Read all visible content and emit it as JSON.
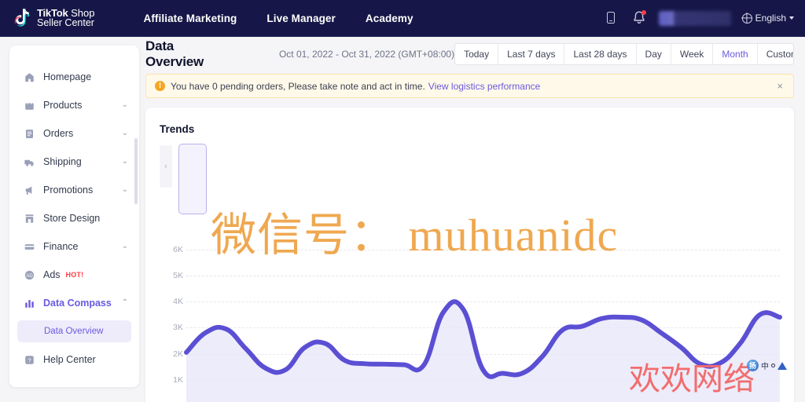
{
  "topnav": {
    "brand": {
      "line1_bold": "TikTok",
      "line1_rest": " Shop",
      "line2": "Seller Center"
    },
    "links": [
      {
        "label": "Affiliate Marketing"
      },
      {
        "label": "Live Manager"
      },
      {
        "label": "Academy"
      }
    ],
    "language": {
      "label": "English"
    },
    "icons": {
      "phone": "mobile-phone-icon",
      "bell": "notification-bell-icon",
      "globe": "globe-icon"
    }
  },
  "sidebar": {
    "items": [
      {
        "label": "Homepage",
        "icon": "home-icon",
        "caret": false,
        "active": false
      },
      {
        "label": "Products",
        "icon": "bag-icon",
        "caret": true,
        "active": false
      },
      {
        "label": "Orders",
        "icon": "document-icon",
        "caret": true,
        "active": false
      },
      {
        "label": "Shipping",
        "icon": "truck-icon",
        "caret": true,
        "active": false
      },
      {
        "label": "Promotions",
        "icon": "megaphone-icon",
        "caret": true,
        "active": false
      },
      {
        "label": "Store Design",
        "icon": "storefront-icon",
        "caret": false,
        "active": false
      },
      {
        "label": "Finance",
        "icon": "card-icon",
        "caret": true,
        "active": false
      },
      {
        "label": "Ads",
        "icon": "ads-icon",
        "caret": false,
        "active": false,
        "badge": "HOT!"
      },
      {
        "label": "Data Compass",
        "icon": "bar-chart-icon",
        "caret": true,
        "active": true
      },
      {
        "label": "Help Center",
        "icon": "help-icon",
        "caret": false,
        "active": false
      }
    ],
    "submenu": {
      "label": "Data Overview"
    },
    "caret_down": "⌄",
    "caret_up": "⌃"
  },
  "header": {
    "title": "Data Overview",
    "date_range": "Oct 01, 2022 - Oct 31, 2022 (GMT+08:00)",
    "ranges": [
      {
        "label": "Today",
        "selected": false
      },
      {
        "label": "Last 7 days",
        "selected": false
      },
      {
        "label": "Last 28 days",
        "selected": false
      },
      {
        "label": "Day",
        "selected": false
      },
      {
        "label": "Week",
        "selected": false
      },
      {
        "label": "Month",
        "selected": true
      },
      {
        "label": "Custom",
        "selected": false
      }
    ]
  },
  "alert": {
    "icon_glyph": "!",
    "text": "You have 0 pending orders, Please take note and act in time.",
    "link": "View logistics performance",
    "close_glyph": "×"
  },
  "trends_card": {
    "title": "Trends",
    "carousel_prev_glyph": "‹"
  },
  "chart_data": {
    "type": "area",
    "title": "Trends",
    "xlabel": "",
    "ylabel": "",
    "ylim": [
      0,
      6500
    ],
    "yticks": [
      6000,
      5000,
      4000,
      3000,
      2000,
      1000
    ],
    "ytick_labels": [
      "6K",
      "5K",
      "4K",
      "3K",
      "2K",
      "1K"
    ],
    "grid": true,
    "legend_position": "none",
    "line_color": "#5b4fd4",
    "fill_color": "#e7e5f8",
    "series": [
      {
        "name": "Trend",
        "x": [
          0,
          1,
          2,
          3,
          4,
          5,
          6,
          7,
          8,
          9,
          10,
          11,
          12,
          13,
          14,
          15,
          16,
          17,
          18,
          19,
          20,
          21,
          22,
          23,
          24,
          25,
          26,
          27,
          28,
          29,
          30
        ],
        "values": [
          2050,
          2820,
          2950,
          2200,
          1450,
          1380,
          2250,
          2400,
          1750,
          1620,
          1600,
          1580,
          1560,
          3600,
          3700,
          1380,
          1250,
          1260,
          1900,
          2900,
          3050,
          3350,
          3400,
          3300,
          2800,
          2250,
          1600,
          1650,
          2400,
          3500,
          3400
        ]
      }
    ]
  },
  "watermarks": {
    "orange": "微信号： muhuanidc",
    "red": "欢欢网络",
    "ime_logo": "扬",
    "ime_text": "中"
  }
}
